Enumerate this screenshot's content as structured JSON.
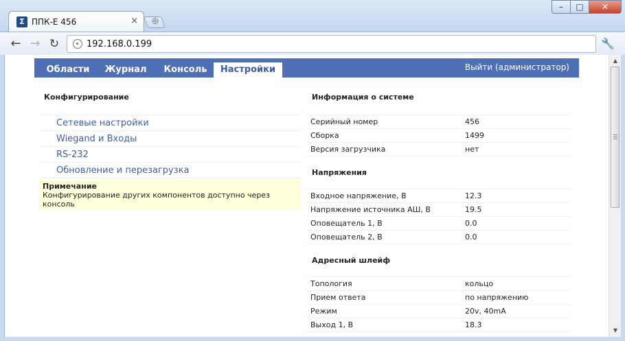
{
  "browser": {
    "tab_title": "ППК-Е 456",
    "tab_favicon": "Σ",
    "address": "192.168.0.199"
  },
  "app": {
    "nav": [
      {
        "label": "Области"
      },
      {
        "label": "Журнал"
      },
      {
        "label": "Консоль"
      },
      {
        "label": "Настройки"
      }
    ],
    "logout": "Выйти (администратор)"
  },
  "config": {
    "title": "Конфигурирование",
    "items": [
      {
        "label": "Сетевые настройки"
      },
      {
        "label": "Wiegand и Входы"
      },
      {
        "label": "RS-232"
      },
      {
        "label": "Обновление и перезагрузка"
      }
    ],
    "note_title": "Примечание",
    "note_text": "Конфигурирование других компонентов доступно через консоль"
  },
  "sysinfo": {
    "title": "Информация о системе",
    "rows": [
      {
        "key": "Серийный номер",
        "value": "456"
      },
      {
        "key": "Сборка",
        "value": "1499"
      },
      {
        "key": "Версия загрузчика",
        "value": "нет"
      }
    ]
  },
  "voltage": {
    "title": "Напряжения",
    "rows": [
      {
        "key": "Входное напряжение, В",
        "value": "12.3"
      },
      {
        "key": "Напряжение источника АШ, В",
        "value": "19.5"
      },
      {
        "key": "Оповещатель 1, В",
        "value": "0.0"
      },
      {
        "key": "Оповещатель 2, В",
        "value": "0.0"
      }
    ]
  },
  "loop": {
    "title": "Адресный шлейф",
    "rows": [
      {
        "key": "Топология",
        "value": "кольцо"
      },
      {
        "key": "Прием ответа",
        "value": "по напряжению"
      },
      {
        "key": "Режим",
        "value": "20v, 40mA"
      },
      {
        "key": "Выход 1, В",
        "value": "18.3"
      }
    ]
  }
}
